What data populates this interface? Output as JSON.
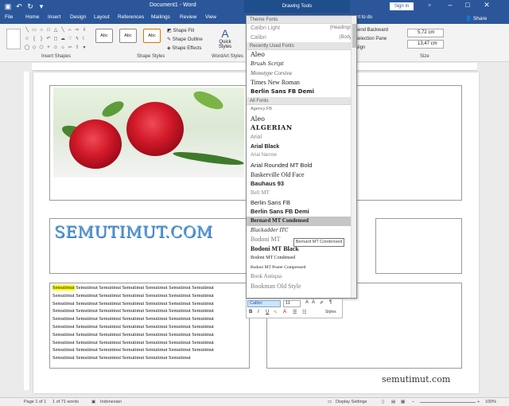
{
  "window": {
    "title": "Document1 - Word",
    "contextual_tab_group": "Drawing Tools",
    "sign_in_label": "Sign in",
    "share_label": "Share"
  },
  "ribbon_tabs": [
    "File",
    "Home",
    "Insert",
    "Design",
    "Layout",
    "References",
    "Mailings",
    "Review",
    "View"
  ],
  "tell_me": "nt to do",
  "ribbon": {
    "shape_fill": "Shape Fill",
    "shape_outline": "Shape Outline",
    "shape_effects": "Shape Effects",
    "style_sample": "Abc",
    "quick_styles": "Quick Styles",
    "insert_shapes_label": "Insert Shapes",
    "shape_styles_label": "Shape Styles",
    "wordart_styles_label": "WordArt Styles",
    "bring_backward": "Send Backward",
    "selection_pane": "Selection Pane",
    "align": "Align",
    "size_label": "Size",
    "height_value": "5,72 cm",
    "width_value": "13,47 cm"
  },
  "document": {
    "heading": "SEMUTIMUT.COM",
    "highlighted_word": "Semutimut",
    "para_lines": [
      " Semutimut Semutimut Semutimut Semutimut Semutimut Semutimut",
      "Semutimut Semutimut Semutimut Semutimut Semutimut Semutimut Semutimut",
      "Semutimut Semutimut Semutimut Semutimut Semutimut Semutimut Semutimut",
      "Semutimut Semutimut Semutimut Semutimut Semutimut Semutimut Semutimut",
      "Semutimut Semutimut Semutimut Semutimut Semutimut Semutimut Semutimut",
      "Semutimut Semutimut Semutimut Semutimut Semutimut Semutimut Semutimut",
      "Semutimut Semutimut Semutimut Semutimut Semutimut Semutimut Semutimut",
      "Semutimut Semutimut Semutimut Semutimut Semutimut Semutimut Semutimut",
      "Semutimut Semutimut Semutimut Semutimut Semutimut Semutimut Semutimut",
      "Semutimut Semutimut Semutimut Semutimut Semutimut Semutimut"
    ],
    "watermark": "semutimut.com"
  },
  "font_dropdown": {
    "theme_fonts_header": "Theme Fonts",
    "theme_fonts": [
      {
        "name": "Calibri Light",
        "tag": "(Headings)"
      },
      {
        "name": "Calibri",
        "tag": "(Body)"
      }
    ],
    "recent_header": "Recently Used Fonts",
    "recent_fonts": [
      "Aleo",
      "Brush Script",
      "Monotype Corsiva",
      "Times New Roman",
      "Berlin Sans FB Demi"
    ],
    "all_header": "All Fonts",
    "all_fonts": [
      "Agency FB",
      "Aleo",
      "ALGERIAN",
      "Arial",
      "Arial Black",
      "Arial Narrow",
      "Arial Rounded MT Bold",
      "Baskerville Old Face",
      "Bauhaus 93",
      "Bell MT",
      "Berlin Sans FB",
      "Berlin Sans FB Demi",
      "Bernard MT Condensed",
      "Blackadder ITC",
      "Bodoni MT",
      "Bodoni MT Black",
      "Bodoni MT Condensed",
      "Bodoni MT Poster Compressed",
      "Book Antiqua",
      "Bookman Old Style"
    ],
    "selected_font": "Bernard MT Condensed",
    "tooltip": "Bernard MT Condensed"
  },
  "mini_toolbar": {
    "font_value": "Calibri",
    "size_value": "11",
    "bold": "B",
    "italic": "I",
    "underline": "U",
    "styles": "Styles"
  },
  "status_bar": {
    "page": "Page 1 of 1",
    "words": "1 of 71 words",
    "language": "Indonesian",
    "display_settings": "Display Settings",
    "zoom": "100%"
  },
  "colors": {
    "word_blue": "#2b579a",
    "heading_blue": "#5b9bd5",
    "highlight": "#ffff00"
  }
}
